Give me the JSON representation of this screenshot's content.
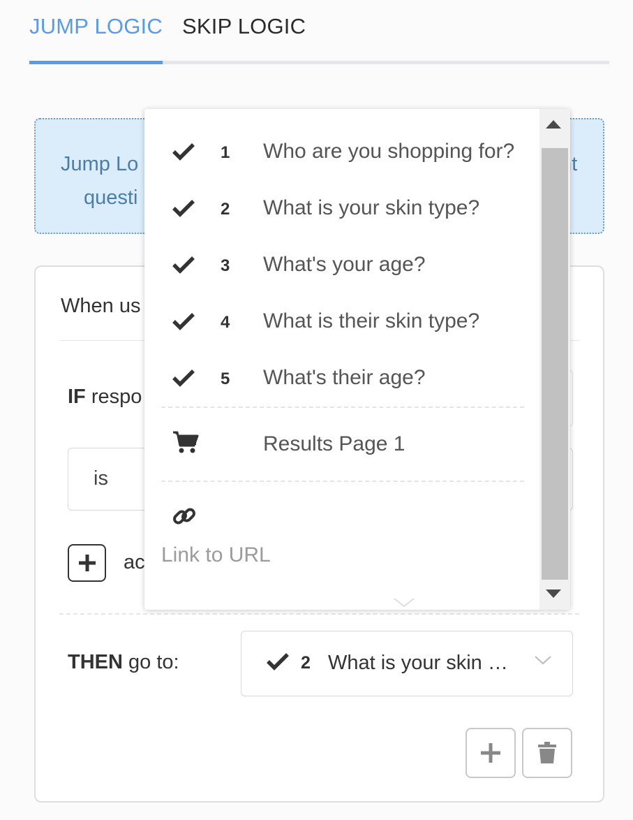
{
  "tabs": [
    {
      "label": "JUMP LOGIC",
      "active": true
    },
    {
      "label": "SKIP LOGIC",
      "active": false
    }
  ],
  "info": {
    "text_left": "Jump Lo",
    "text_left_2": "questi",
    "text_right": "nt"
  },
  "rule": {
    "when_label": "When us",
    "if_bold": "IF",
    "if_rest": " respo",
    "condition_value": "is",
    "add_condition_label": "ac",
    "then_bold": "THEN",
    "then_rest": " go to:",
    "goto": {
      "check_icon": "check-icon",
      "number": "2",
      "text": "What is your skin …",
      "chevron_icon": "chevron-down-icon"
    },
    "buttons": {
      "add_icon": "plus-icon",
      "delete_icon": "trash-icon"
    }
  },
  "dropdown": {
    "questions": [
      {
        "number": "1",
        "text": "Who are you shopping for?"
      },
      {
        "number": "2",
        "text": "What is your skin type?"
      },
      {
        "number": "3",
        "text": "What's your age?"
      },
      {
        "number": "4",
        "text": "What is their skin type?"
      },
      {
        "number": "5",
        "text": "What's their age?"
      }
    ],
    "results_label": "Results Page 1",
    "results_icon": "cart-icon",
    "link_label": "Link to URL",
    "link_icon": "link-icon"
  },
  "colors": {
    "accent": "#5a9be6",
    "info_bg": "#dbecfb",
    "info_text": "#4a7ea9"
  }
}
